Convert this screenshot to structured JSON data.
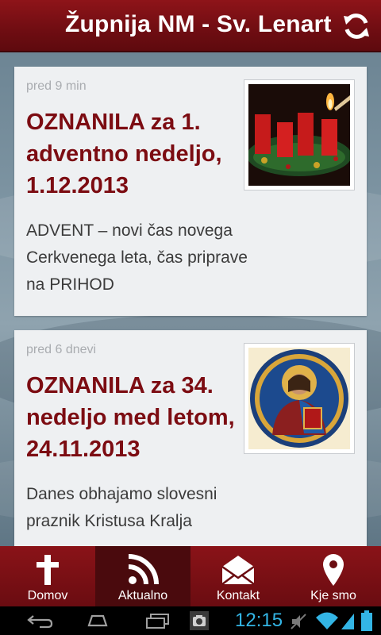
{
  "app": {
    "title": "Župnija NM - Sv. Lenart"
  },
  "header": {
    "refresh_icon": "refresh-icon"
  },
  "posts": [
    {
      "time": "pred 9 min",
      "title": "OZNANILA za 1. adventno nedeljo, 1.12.2013",
      "excerpt": "ADVENT – novi čas novega Cerkvenega leta, čas priprave na PRIHOD",
      "thumbnail": "advent-wreath-image"
    },
    {
      "time": "pred 6 dnevi",
      "title": "OZNANILA za 34. nedeljo med letom, 24.11.2013",
      "excerpt": "Danes obhajamo slovesni praznik Kristusa Kralja",
      "thumbnail": "christ-icon-image"
    }
  ],
  "bottom_nav": {
    "items": [
      {
        "label": "Domov",
        "icon": "cross-icon",
        "active": false
      },
      {
        "label": "Aktualno",
        "icon": "rss-icon",
        "active": true
      },
      {
        "label": "Kontakt",
        "icon": "mail-icon",
        "active": false
      },
      {
        "label": "Kje smo",
        "icon": "location-pin-icon",
        "active": false
      }
    ]
  },
  "system_bar": {
    "clock": "12:15",
    "accent_color": "#33b5e5"
  },
  "colors": {
    "brand": "#7c0c12",
    "header": "#6f0d12"
  }
}
